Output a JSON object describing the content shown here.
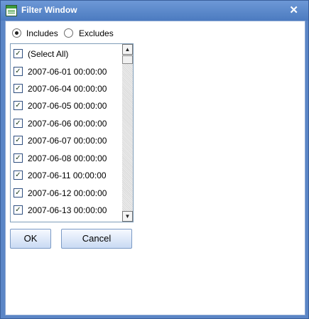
{
  "window": {
    "title": "Filter Window",
    "close_glyph": "✕"
  },
  "filter_mode": {
    "options": [
      {
        "label": "Includes",
        "selected": true
      },
      {
        "label": "Excludes",
        "selected": false
      }
    ]
  },
  "list": {
    "items": [
      {
        "label": "(Select All)",
        "checked": true
      },
      {
        "label": "2007-06-01 00:00:00",
        "checked": true
      },
      {
        "label": "2007-06-04 00:00:00",
        "checked": true
      },
      {
        "label": "2007-06-05 00:00:00",
        "checked": true
      },
      {
        "label": "2007-06-06 00:00:00",
        "checked": true
      },
      {
        "label": "2007-06-07 00:00:00",
        "checked": true
      },
      {
        "label": "2007-06-08 00:00:00",
        "checked": true
      },
      {
        "label": "2007-06-11 00:00:00",
        "checked": true
      },
      {
        "label": "2007-06-12 00:00:00",
        "checked": true
      },
      {
        "label": "2007-06-13 00:00:00",
        "checked": true
      }
    ],
    "check_glyph": "✓",
    "scroll_up_glyph": "▲",
    "scroll_down_glyph": "▼"
  },
  "buttons": {
    "ok": "OK",
    "cancel": "Cancel"
  }
}
